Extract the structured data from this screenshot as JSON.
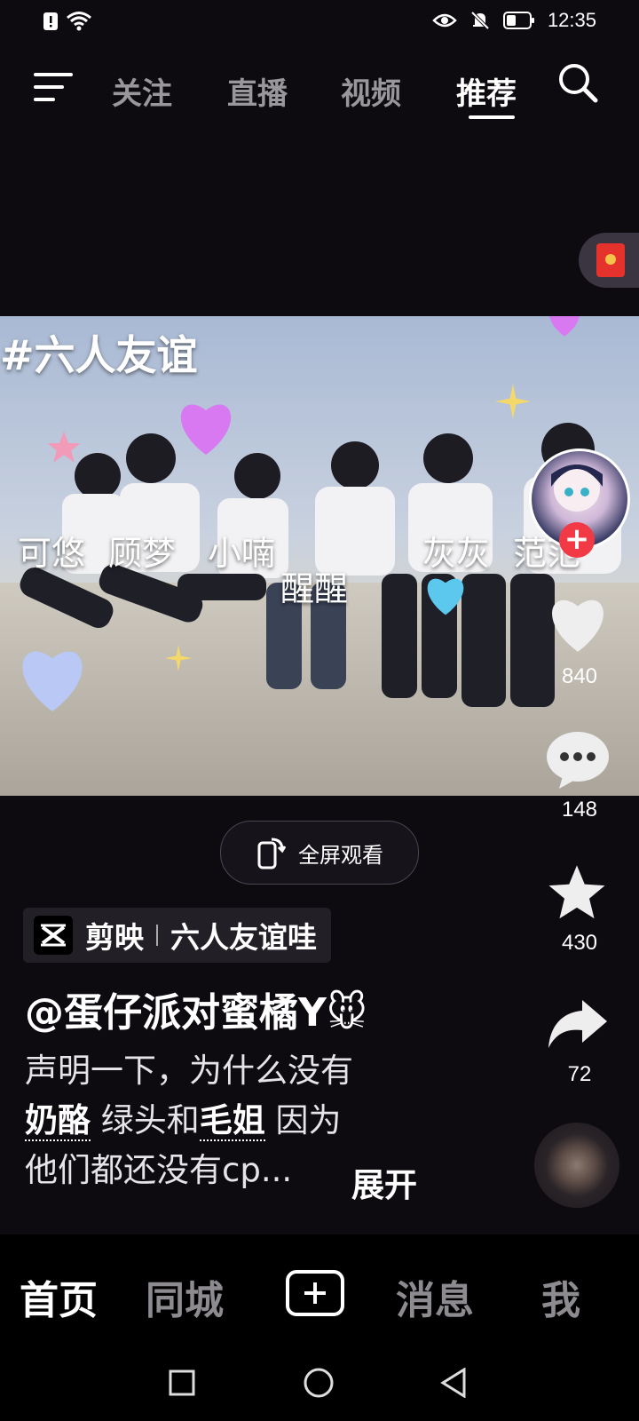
{
  "status_bar": {
    "time": "12:35"
  },
  "top_tabs": [
    {
      "label": "关注"
    },
    {
      "label": "直播"
    },
    {
      "label": "视频"
    },
    {
      "label": "推荐",
      "active": true
    }
  ],
  "video": {
    "hashtag": "#六人友谊",
    "overlay_names": [
      "可悠",
      "顾梦",
      "小喃",
      "醒醒",
      "灰灰",
      "范范"
    ]
  },
  "actions": {
    "like_count": "840",
    "comment_count": "148",
    "favorite_count": "430",
    "share_count": "72"
  },
  "fullscreen_label": "全屏观看",
  "source_tag": {
    "app": "剪映",
    "template": "六人友谊哇"
  },
  "post": {
    "author": "@蛋仔派对蜜橘Y🐭",
    "desc_line1": "声明一下，为什么没有",
    "tag1": "奶酪",
    "desc_mid": " 绿头和",
    "tag2": "毛姐",
    "desc_mid2": " 因为",
    "desc_line3": "他们都还没有cp...",
    "more_label": "展开"
  },
  "bottom_nav": [
    {
      "label": "首页",
      "active": true
    },
    {
      "label": "同城"
    },
    {
      "label": "消息"
    },
    {
      "label": "我"
    }
  ],
  "colors": {
    "background": "#0d0a10",
    "follow_plus": "#f13a45",
    "red_packet": "#e5322d"
  }
}
